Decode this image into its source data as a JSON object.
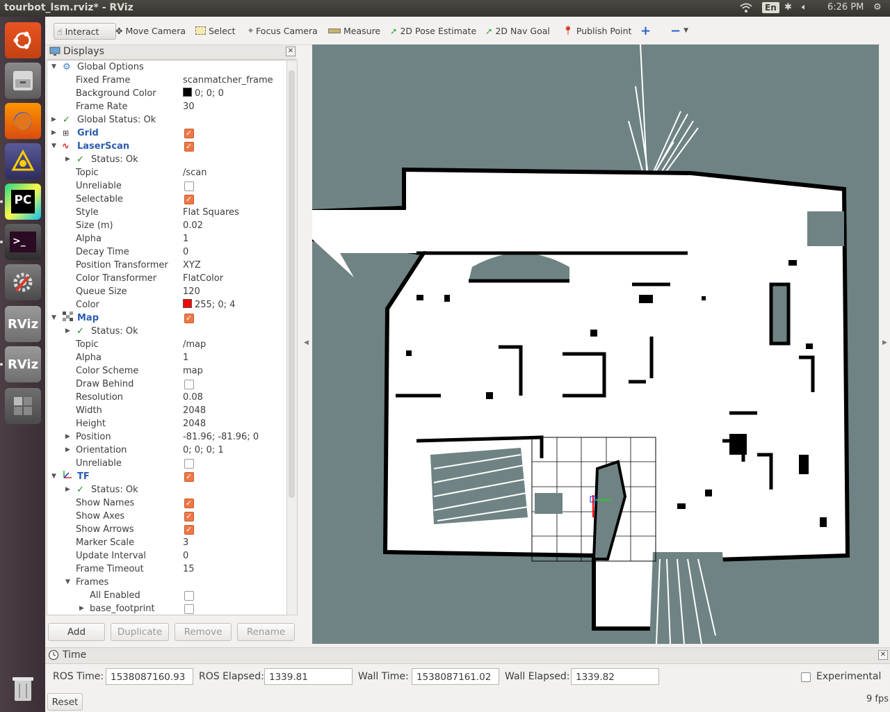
{
  "window": {
    "title": "tourbot_lsm.rviz* - RViz"
  },
  "tray": {
    "keyboard": "En",
    "clock": "6:26 PM"
  },
  "launcher": {
    "items": [
      "ubuntu-logo",
      "file-cabinet",
      "firefox",
      "qgis",
      "pycharm",
      "terminal",
      "system-settings",
      "rviz",
      "rviz",
      "workspace-switcher",
      "trash"
    ],
    "pycharm_label": "PC",
    "terminal_label": ">_",
    "rviz_label": "RViz"
  },
  "toolbar": {
    "interact": "Interact",
    "move_camera": "Move Camera",
    "select": "Select",
    "focus_camera": "Focus Camera",
    "measure": "Measure",
    "pose_estimate": "2D Pose Estimate",
    "nav_goal": "2D Nav Goal",
    "publish_point": "Publish Point"
  },
  "displays": {
    "title": "Displays",
    "rows": [
      {
        "label": "Global Options",
        "value": ""
      },
      {
        "label": "Fixed Frame",
        "value": "scanmatcher_frame"
      },
      {
        "label": "Background Color",
        "value": "0; 0; 0"
      },
      {
        "label": "Frame Rate",
        "value": "30"
      },
      {
        "label": "Global Status: Ok",
        "value": ""
      },
      {
        "label": "Grid",
        "value": ""
      },
      {
        "label": "LaserScan",
        "value": ""
      },
      {
        "label": "Status: Ok",
        "value": ""
      },
      {
        "label": "Topic",
        "value": "/scan"
      },
      {
        "label": "Unreliable",
        "value": ""
      },
      {
        "label": "Selectable",
        "value": ""
      },
      {
        "label": "Style",
        "value": "Flat Squares"
      },
      {
        "label": "Size (m)",
        "value": "0.02"
      },
      {
        "label": "Alpha",
        "value": "1"
      },
      {
        "label": "Decay Time",
        "value": "0"
      },
      {
        "label": "Position Transformer",
        "value": "XYZ"
      },
      {
        "label": "Color Transformer",
        "value": "FlatColor"
      },
      {
        "label": "Queue Size",
        "value": "120"
      },
      {
        "label": "Color",
        "value": "255; 0; 4"
      },
      {
        "label": "Map",
        "value": ""
      },
      {
        "label": "Status: Ok",
        "value": ""
      },
      {
        "label": "Topic",
        "value": "/map"
      },
      {
        "label": "Alpha",
        "value": "1"
      },
      {
        "label": "Color Scheme",
        "value": "map"
      },
      {
        "label": "Draw Behind",
        "value": ""
      },
      {
        "label": "Resolution",
        "value": "0.08"
      },
      {
        "label": "Width",
        "value": "2048"
      },
      {
        "label": "Height",
        "value": "2048"
      },
      {
        "label": "Position",
        "value": "-81.96; -81.96; 0"
      },
      {
        "label": "Orientation",
        "value": "0; 0; 0; 1"
      },
      {
        "label": "Unreliable",
        "value": ""
      },
      {
        "label": "TF",
        "value": ""
      },
      {
        "label": "Status: Ok",
        "value": ""
      },
      {
        "label": "Show Names",
        "value": ""
      },
      {
        "label": "Show Axes",
        "value": ""
      },
      {
        "label": "Show Arrows",
        "value": ""
      },
      {
        "label": "Marker Scale",
        "value": "3"
      },
      {
        "label": "Update Interval",
        "value": "0"
      },
      {
        "label": "Frame Timeout",
        "value": "15"
      },
      {
        "label": "Frames",
        "value": ""
      },
      {
        "label": "All Enabled",
        "value": ""
      },
      {
        "label": "base_footprint",
        "value": ""
      }
    ],
    "buttons": {
      "add": "Add",
      "duplicate": "Duplicate",
      "remove": "Remove",
      "rename": "Rename"
    }
  },
  "time": {
    "title": "Time",
    "ros_time_label": "ROS Time:",
    "ros_time": "1538087160.93",
    "ros_elapsed_label": "ROS Elapsed:",
    "ros_elapsed": "1339.81",
    "wall_time_label": "Wall Time:",
    "wall_time": "1538087161.02",
    "wall_elapsed_label": "Wall Elapsed:",
    "wall_elapsed": "1339.82",
    "experimental": "Experimental",
    "reset": "Reset",
    "fps": "9 fps"
  },
  "colors": {
    "map_unknown": "#6f8384",
    "map_free": "#ffffff",
    "map_occupied": "#000000",
    "scan": "#ff0004",
    "accent": "#f07746"
  }
}
